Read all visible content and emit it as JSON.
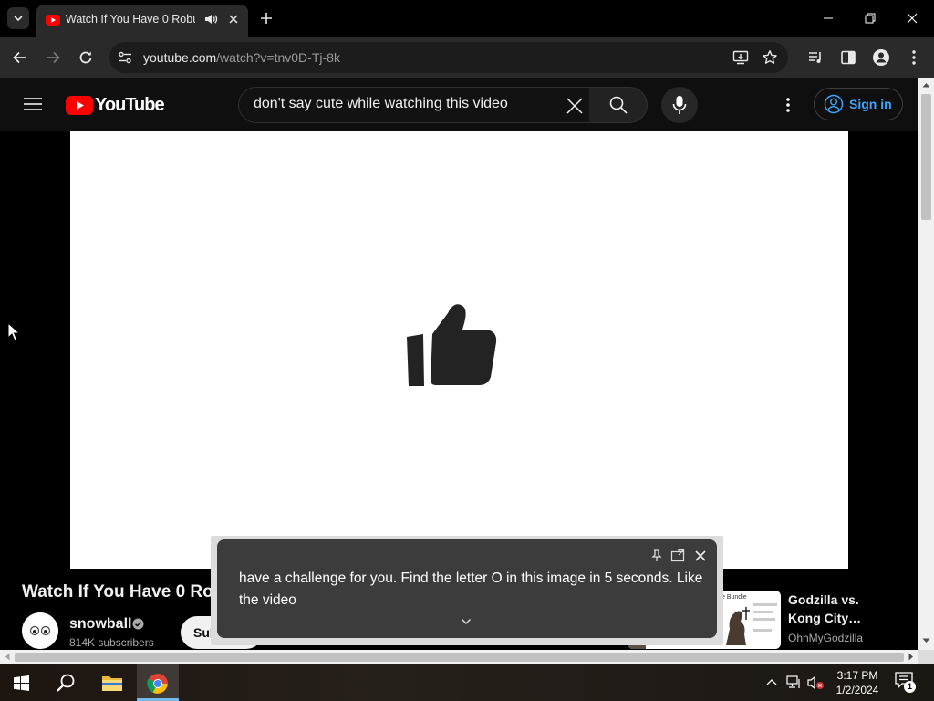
{
  "browser": {
    "tab_title": "Watch If You Have 0 Robux",
    "url_domain": "youtube.com",
    "url_path": "/watch?v=tnv0D-Tj-8k"
  },
  "youtube": {
    "logo_text": "YouTube",
    "search_value": "don't say cute while watching this video",
    "signin_label": "Sign in"
  },
  "video": {
    "title": "Watch If You Have 0 Ro",
    "channel_name": "snowball",
    "subscribers": "814K subscribers",
    "subscribe_label": "Sul"
  },
  "recommended": {
    "title": "Godzilla vs. Kong City…",
    "channel": "OhhMyGodzilla",
    "thumb_label": "e Bundle"
  },
  "live_caption": {
    "text": "have a challenge for you. Find the letter O in this image in 5 seconds. Like the video"
  },
  "taskbar": {
    "time": "3:17 PM",
    "date": "1/2/2024",
    "notification_count": "1"
  },
  "colors": {
    "youtube_red": "#ff0000",
    "link_blue": "#3ea6ff",
    "windows_blue": "#00a4ef"
  }
}
